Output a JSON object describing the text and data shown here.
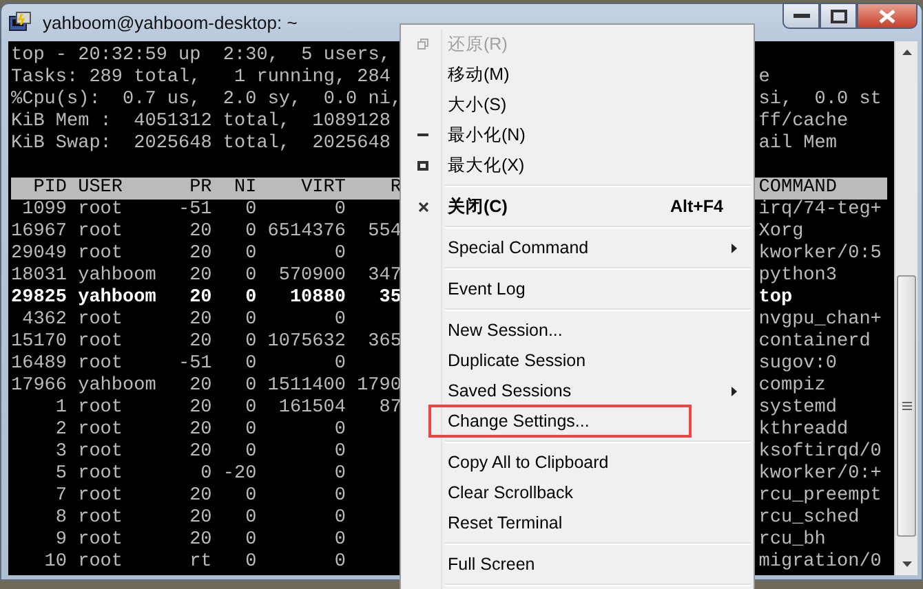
{
  "window": {
    "title": "yahboom@yahboom-desktop: ~"
  },
  "terminal": {
    "summary_lines": [
      {
        "left": "top - 20:32:59 up  2:30,  5 users,"
      },
      {
        "left": "Tasks: 289 total,   1 running, 284 ",
        "right": "e"
      },
      {
        "left": "%Cpu(s):  0.7 us,  2.0 sy,  0.0 ni,",
        "right": "si,  0.0 st"
      },
      {
        "left": "KiB Mem :  4051312 total,  1089128 ",
        "right": "ff/cache"
      },
      {
        "left": "KiB Swap:  2025648 total,  2025648 ",
        "right": "ail Mem"
      }
    ],
    "table": {
      "columns": [
        "PID",
        "USER",
        "PR",
        "NI",
        "VIRT",
        "R",
        "COMMAND"
      ],
      "rows": [
        {
          "pid": "1099",
          "user": "root",
          "pr": "-51",
          "ni": "0",
          "virt": "0",
          "command": "irq/74-teg+",
          "bold": false
        },
        {
          "pid": "16967",
          "user": "root",
          "pr": "20",
          "ni": "0",
          "virt": "6514376",
          "column_6": "554",
          "command": "Xorg",
          "bold": false
        },
        {
          "pid": "29049",
          "user": "root",
          "pr": "20",
          "ni": "0",
          "virt": "0",
          "command": "kworker/0:5",
          "bold": false
        },
        {
          "pid": "18031",
          "user": "yahboom",
          "pr": "20",
          "ni": "0",
          "virt": "570900",
          "column_6": "347",
          "command": "python3",
          "bold": false
        },
        {
          "pid": "29825",
          "user": "yahboom",
          "pr": "20",
          "ni": "0",
          "virt": "10880",
          "column_6": "35",
          "command": "top",
          "bold": true
        },
        {
          "pid": "4362",
          "user": "root",
          "pr": "20",
          "ni": "0",
          "virt": "0",
          "command": "nvgpu_chan+",
          "bold": false
        },
        {
          "pid": "15170",
          "user": "root",
          "pr": "20",
          "ni": "0",
          "virt": "1075632",
          "column_6": "365",
          "command": "containerd",
          "bold": false
        },
        {
          "pid": "16489",
          "user": "root",
          "pr": "-51",
          "ni": "0",
          "virt": "0",
          "command": "sugov:0",
          "bold": false
        },
        {
          "pid": "17966",
          "user": "yahboom",
          "pr": "20",
          "ni": "0",
          "virt": "1511400",
          "column_6": "1790",
          "command": "compiz",
          "bold": false
        },
        {
          "pid": "1",
          "user": "root",
          "pr": "20",
          "ni": "0",
          "virt": "161504",
          "column_6": "87",
          "command": "systemd",
          "bold": false
        },
        {
          "pid": "2",
          "user": "root",
          "pr": "20",
          "ni": "0",
          "virt": "0",
          "command": "kthreadd",
          "bold": false
        },
        {
          "pid": "3",
          "user": "root",
          "pr": "20",
          "ni": "0",
          "virt": "0",
          "command": "ksoftirqd/0",
          "bold": false
        },
        {
          "pid": "5",
          "user": "root",
          "pr": "0",
          "ni": "-20",
          "virt": "0",
          "command": "kworker/0:+",
          "bold": false
        },
        {
          "pid": "7",
          "user": "root",
          "pr": "20",
          "ni": "0",
          "virt": "0",
          "command": "rcu_preempt",
          "bold": false
        },
        {
          "pid": "8",
          "user": "root",
          "pr": "20",
          "ni": "0",
          "virt": "0",
          "command": "rcu_sched",
          "bold": false
        },
        {
          "pid": "9",
          "user": "root",
          "pr": "20",
          "ni": "0",
          "virt": "0",
          "command": "rcu_bh",
          "bold": false
        },
        {
          "pid": "10",
          "user": "root",
          "pr": "rt",
          "ni": "0",
          "virt": "0",
          "command": "migration/0",
          "bold": false
        }
      ]
    }
  },
  "menu": {
    "items": [
      {
        "kind": "restore",
        "label": "还原(R)",
        "disabled": true
      },
      {
        "kind": "plain",
        "label": "移动(M)",
        "disabled": false
      },
      {
        "kind": "plain",
        "label": "大小(S)",
        "disabled": false
      },
      {
        "kind": "minimize",
        "label": "最小化(N)",
        "disabled": false
      },
      {
        "kind": "maximize",
        "label": "最大化(X)",
        "disabled": false
      },
      {
        "kind": "separator"
      },
      {
        "kind": "close",
        "label": "关闭(C)",
        "shortcut": "Alt+F4",
        "bold": true,
        "disabled": false
      },
      {
        "kind": "separator"
      },
      {
        "kind": "plain",
        "label": "Special Command",
        "submenu": true,
        "disabled": false
      },
      {
        "kind": "separator"
      },
      {
        "kind": "plain",
        "label": "Event Log",
        "disabled": false
      },
      {
        "kind": "separator"
      },
      {
        "kind": "plain",
        "label": "New Session...",
        "disabled": false
      },
      {
        "kind": "plain",
        "label": "Duplicate Session",
        "disabled": false
      },
      {
        "kind": "plain",
        "label": "Saved Sessions",
        "submenu": true,
        "disabled": false
      },
      {
        "kind": "plain",
        "label": "Change Settings...",
        "outlined": true,
        "disabled": false
      },
      {
        "kind": "separator"
      },
      {
        "kind": "plain",
        "label": "Copy All to Clipboard",
        "disabled": false
      },
      {
        "kind": "plain",
        "label": "Clear Scrollback",
        "disabled": false
      },
      {
        "kind": "plain",
        "label": "Reset Terminal",
        "disabled": false
      },
      {
        "kind": "separator"
      },
      {
        "kind": "plain",
        "label": "Full Screen",
        "disabled": false
      },
      {
        "kind": "separator"
      }
    ]
  }
}
